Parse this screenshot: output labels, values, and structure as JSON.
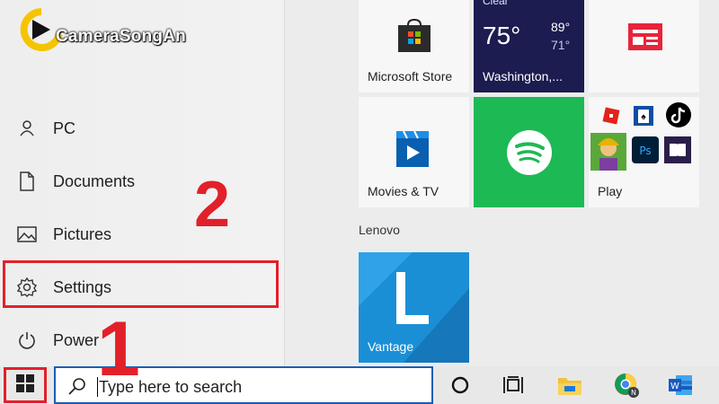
{
  "logo": {
    "text": "CameraSongAn"
  },
  "nav": {
    "pc": "PC",
    "documents": "Documents",
    "pictures": "Pictures",
    "settings": "Settings",
    "power": "Power"
  },
  "annotations": {
    "step1": "1",
    "step2": "2"
  },
  "tiles": {
    "microsoft_store": "Microsoft Store",
    "weather": {
      "top_text": "Clear",
      "temp": "75°",
      "high": "89°",
      "low": "71°",
      "location": "Washington,..."
    },
    "movies_tv": "Movies & TV",
    "play": "Play",
    "vantage": "Vantage"
  },
  "section": {
    "lenovo": "Lenovo"
  },
  "taskbar": {
    "search_placeholder": "Type here to search"
  },
  "colors": {
    "highlight_red": "#e2202a",
    "spotify_green": "#1db954",
    "weather_bg": "#1c1c50",
    "vantage_blue": "#1b8fd6",
    "search_border": "#1a5fb4"
  }
}
